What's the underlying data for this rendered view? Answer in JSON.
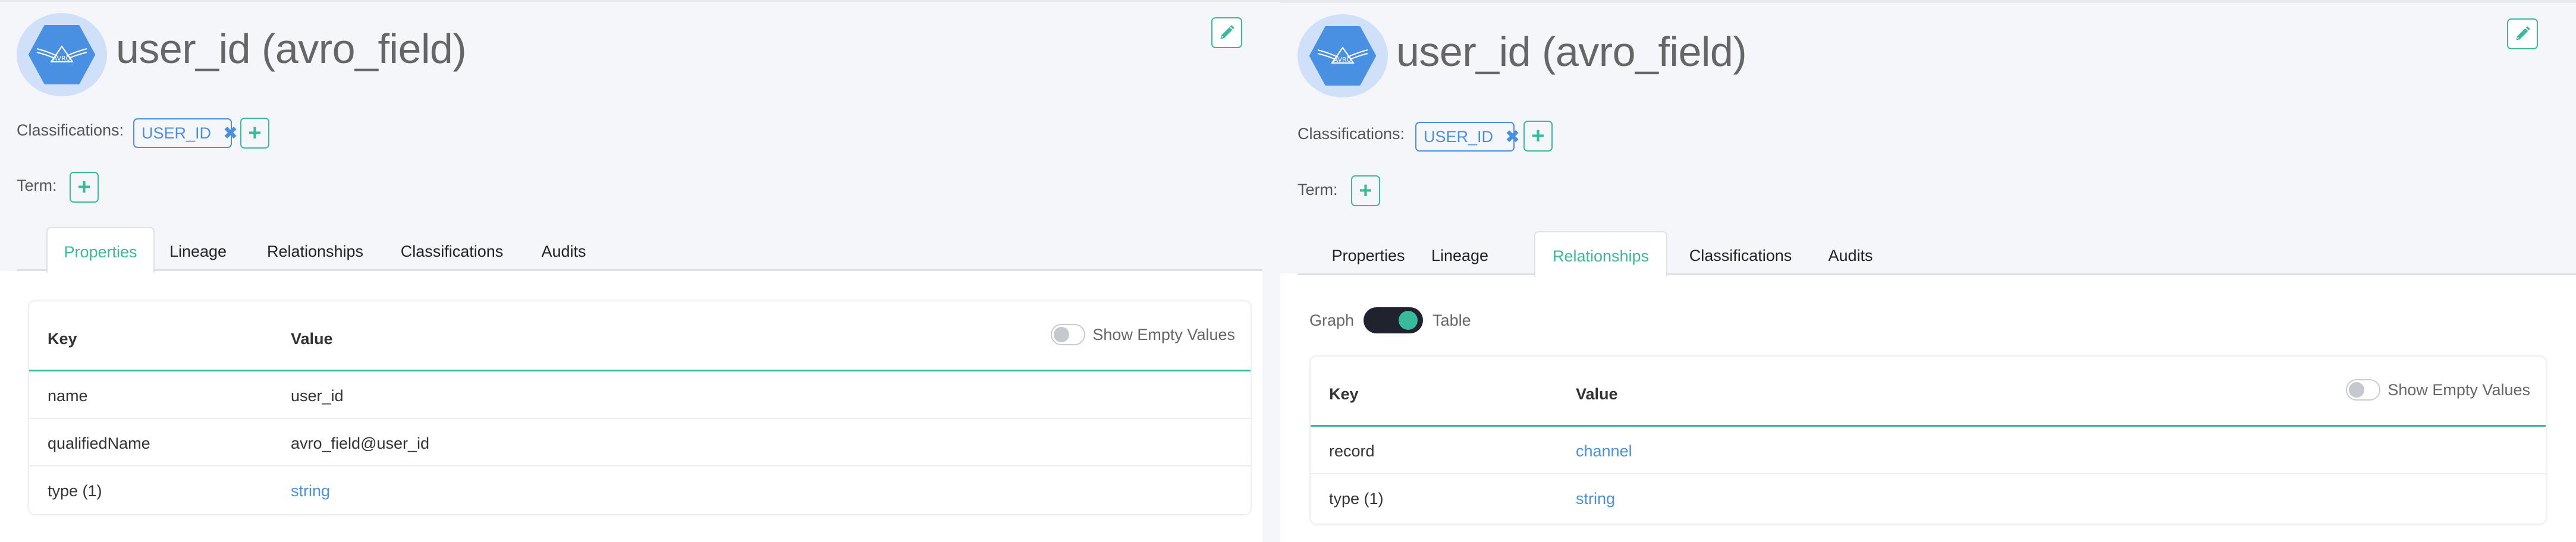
{
  "colors": {
    "accent": "#38bb9b",
    "link": "#4a90e2",
    "avatar_bg": "#cfe0f8",
    "avatar_hex": "#4a90e2",
    "toggle_dark": "#20232e"
  },
  "panels": [
    {
      "entity": {
        "title": "user_id (avro_field)",
        "avatar_icon": "avro-logo-icon",
        "edit_icon": "pencil-icon"
      },
      "classifications": {
        "label": "Classifications:",
        "tags": [
          {
            "label": "USER_ID",
            "remove_icon": "✖"
          }
        ],
        "add_label": "+"
      },
      "term": {
        "label": "Term:",
        "add_label": "+"
      },
      "tabs": [
        {
          "label": "Properties",
          "active": true
        },
        {
          "label": "Lineage",
          "active": false
        },
        {
          "label": "Relationships",
          "active": false
        },
        {
          "label": "Classifications",
          "active": false
        },
        {
          "label": "Audits",
          "active": false
        }
      ],
      "table": {
        "show_empty_label": "Show Empty Values",
        "show_empty_on": false,
        "columns": [
          "Key",
          "Value"
        ],
        "rows": [
          {
            "key": "name",
            "value": "user_id",
            "link": false
          },
          {
            "key": "qualifiedName",
            "value": "avro_field@user_id",
            "link": false
          },
          {
            "key": "type (1)",
            "value": "string",
            "link": true
          }
        ]
      }
    },
    {
      "entity": {
        "title": "user_id (avro_field)",
        "avatar_icon": "avro-logo-icon",
        "edit_icon": "pencil-icon"
      },
      "classifications": {
        "label": "Classifications:",
        "tags": [
          {
            "label": "USER_ID",
            "remove_icon": "✖"
          }
        ],
        "add_label": "+"
      },
      "term": {
        "label": "Term:",
        "add_label": "+"
      },
      "tabs": [
        {
          "label": "Properties",
          "active": false
        },
        {
          "label": "Lineage",
          "active": false
        },
        {
          "label": "Relationships",
          "active": true
        },
        {
          "label": "Classifications",
          "active": false
        },
        {
          "label": "Audits",
          "active": false
        }
      ],
      "view_toggle": {
        "left_label": "Graph",
        "right_label": "Table",
        "selected": "Table"
      },
      "table": {
        "show_empty_label": "Show Empty Values",
        "show_empty_on": false,
        "columns": [
          "Key",
          "Value"
        ],
        "rows": [
          {
            "key": "record",
            "value": "channel",
            "link": true
          },
          {
            "key": "type (1)",
            "value": "string",
            "link": true
          }
        ]
      }
    }
  ]
}
